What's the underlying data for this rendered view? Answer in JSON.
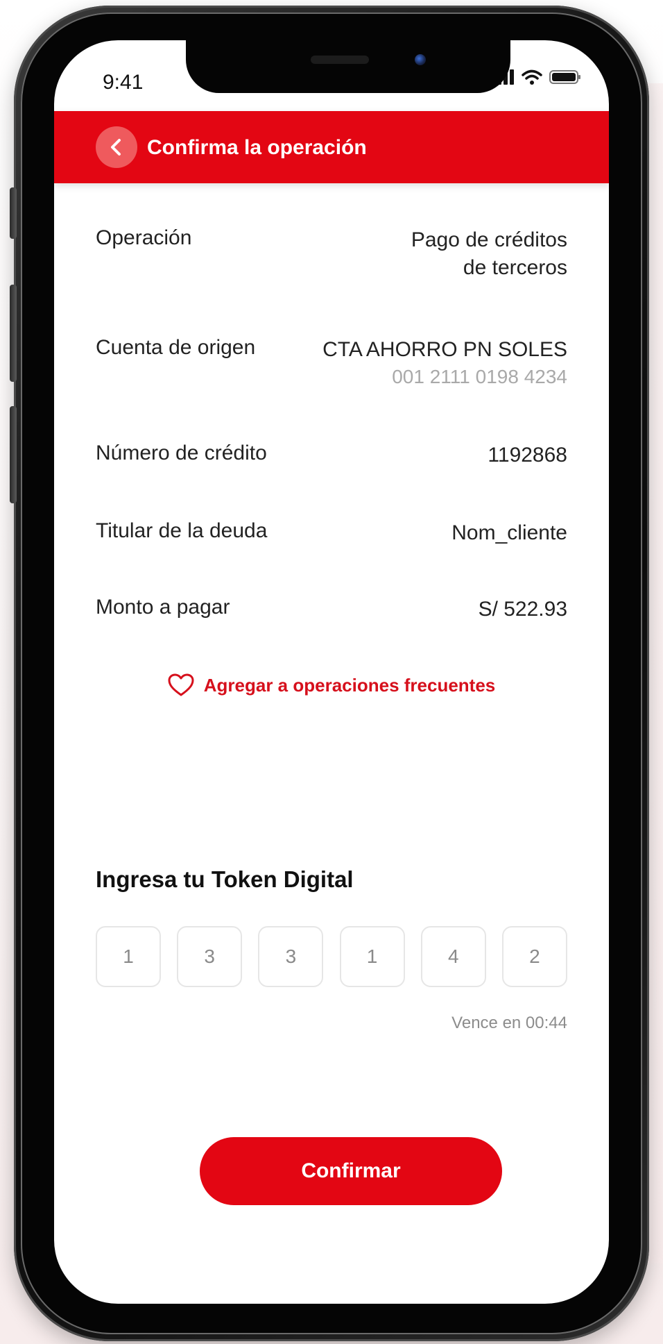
{
  "status_bar": {
    "time": "9:41",
    "signal_icon": "signal-bars-icon",
    "wifi_icon": "wifi-icon",
    "battery_icon": "battery-icon"
  },
  "header": {
    "title": "Confirma la operación",
    "back_icon": "chevron-left-icon",
    "background_color": "#e30613"
  },
  "details": [
    {
      "label": "Operación",
      "value_line1": "Pago de créditos",
      "value_line2": "de terceros"
    },
    {
      "label": "Cuenta de origen",
      "value_line1": "CTA AHORRO PN SOLES",
      "account_number": "001 2111 0198 4234"
    },
    {
      "label": "Número de crédito",
      "value_line1": "1192868"
    },
    {
      "label": "Titular de la deuda",
      "value_line1": "Nom_cliente"
    },
    {
      "label": "Monto a pagar",
      "value_line1": "S/ 522.93"
    }
  ],
  "favorite": {
    "label": "Agregar a operaciones frecuentes",
    "icon": "heart-outline-icon",
    "accent_color": "#d6101c"
  },
  "token": {
    "title": "Ingresa tu Token Digital",
    "digits": [
      "1",
      "3",
      "3",
      "1",
      "4",
      "2"
    ],
    "expiry": "Vence en 00:44"
  },
  "actions": {
    "confirm_label": "Confirmar"
  }
}
